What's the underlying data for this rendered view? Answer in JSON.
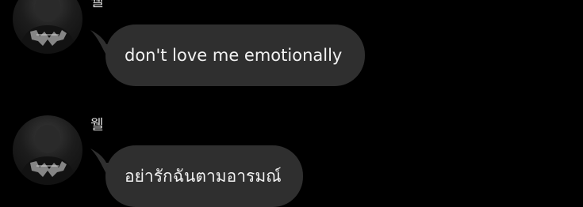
{
  "conversation": {
    "messages": [
      {
        "sender": "웰",
        "text": "don't love me emotionally",
        "avatar_icon": "user-avatar-photo"
      },
      {
        "sender": "웰",
        "text": "อย่ารักฉันตามอารมณ์",
        "avatar_icon": "user-avatar-photo"
      }
    ]
  },
  "colors": {
    "background": "#000000",
    "bubble": "#2f2f2f",
    "text": "#f2f2f2",
    "sender_name": "#d8d8d8"
  }
}
